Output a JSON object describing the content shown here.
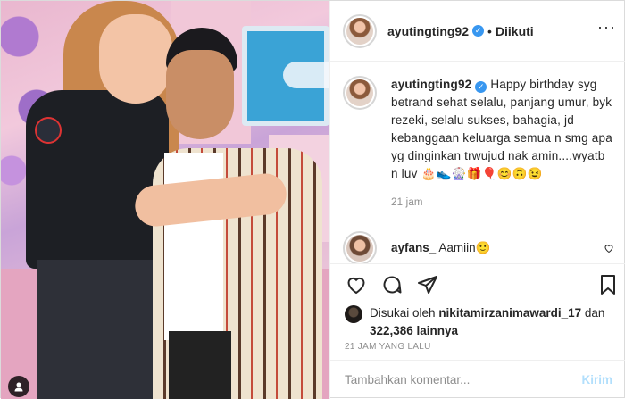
{
  "post": {
    "username": "ayutingting92",
    "follow_status": "Diikuti",
    "caption": "Happy birthday syg betrand sehat selalu, panjang umur, byk rezeki, selalu sukses, bahagia, jd kebanggaan keluarga semua n smg apa yg dinginkan trwujud nak amin....wyatb n luv 🎂👟🎡🎁🎈😊🙃😉",
    "caption_time": "21 jam",
    "comments": [
      {
        "username": "ayfans_",
        "text": "Aamiin🙂"
      }
    ],
    "likes": {
      "prefix": "Disukai oleh",
      "liker": "nikitamirzanimawardi_17",
      "conjunction": "dan",
      "others": "322,386 lainnya"
    },
    "time_ago": "21 JAM YANG LALU",
    "comment_placeholder": "Tambahkan komentar...",
    "send_label": "Kirim"
  },
  "icons": {
    "verified": "verified-badge-icon",
    "more": "more-options-icon",
    "like": "heart-icon",
    "comment": "comment-icon",
    "share": "share-icon",
    "save": "bookmark-icon",
    "user_tag": "user-tag-icon"
  },
  "colors": {
    "verified": "#3897f0",
    "link_disabled": "#b2dffc",
    "secondary_text": "#8e8e8e",
    "border": "#dbdbdb"
  }
}
